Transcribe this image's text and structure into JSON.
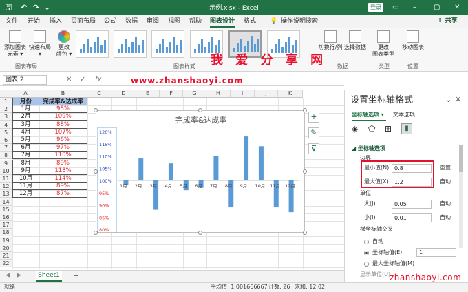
{
  "window": {
    "title": "示例.xlsx  -  Excel",
    "login_label": "登录",
    "minimize": "–",
    "restore": "▢",
    "close": "✕"
  },
  "menu": {
    "items": [
      "文件",
      "开始",
      "插入",
      "页面布局",
      "公式",
      "数据",
      "审阅",
      "视图",
      "帮助",
      "图表设计",
      "格式"
    ],
    "search": "操作说明搜索",
    "share": "共享"
  },
  "ribbon": {
    "add_element": "添加图表\n元素 ▾",
    "quick_layout": "快速布局\n▾",
    "change_color": "更改\n颜色 ▾",
    "switch_rowcol": "切换行/列",
    "select_data": "选择数据",
    "change_type": "更改\n图表类型",
    "move_chart": "移动图表",
    "groups": {
      "layout": "图表布局",
      "styles": "图表样式",
      "data": "数据",
      "type": "类型",
      "location": "位置"
    }
  },
  "watermark": {
    "banner": "我 爱 分 享 网",
    "url": "www.zhanshaoyi.com",
    "corner": "zhanshaoyi.com"
  },
  "formula": {
    "namebox": "图表 2",
    "fx": "fx",
    "cancel": "✕",
    "enter": "✓"
  },
  "columns": [
    "A",
    "B",
    "C",
    "D",
    "E",
    "F",
    "G",
    "H",
    "I",
    "J",
    "K"
  ],
  "rows": [
    "1",
    "2",
    "3",
    "4",
    "5",
    "6",
    "7",
    "8",
    "9",
    "10",
    "11",
    "12",
    "13",
    "14",
    "15",
    "16",
    "17",
    "18",
    "19",
    "20",
    "21",
    "22"
  ],
  "table": {
    "headers": [
      "月份",
      "完成率&达成率"
    ],
    "months": [
      "1月",
      "2月",
      "3月",
      "4月",
      "5月",
      "6月",
      "7月",
      "8月",
      "9月",
      "10月",
      "11月",
      "12月"
    ],
    "values": [
      "98%",
      "109%",
      "88%",
      "107%",
      "96%",
      "97%",
      "110%",
      "89%",
      "118%",
      "114%",
      "89%",
      "87%"
    ]
  },
  "chart_data": {
    "type": "bar",
    "title": "完成率&达成率",
    "categories": [
      "1月",
      "2月",
      "3月",
      "4月",
      "5月",
      "6月",
      "7月",
      "8月",
      "9月",
      "10月",
      "11月",
      "12月"
    ],
    "series": [
      {
        "values": [
          0.98,
          1.09,
          0.88,
          1.07,
          0.96,
          0.97,
          1.1,
          0.89,
          1.18,
          1.14,
          0.89,
          0.87
        ]
      }
    ],
    "ylim": [
      0.8,
      1.2
    ],
    "yticks": [
      "120%",
      "115%",
      "110%",
      "105%",
      "100%",
      "95%",
      "90%",
      "85%",
      "80%"
    ],
    "baseline": 1.0,
    "bar_color": "#5b9bd5",
    "grid": false
  },
  "panel": {
    "title": "设置坐标轴格式",
    "tab1": "坐标轴选项 ▾",
    "tab2": "文本选项",
    "section": "◢ 坐标轴选项",
    "bounds": "边界",
    "min_label": "最小值(N)",
    "min_value": "0.8",
    "reset": "重置",
    "max_label": "最大值(X)",
    "max_value": "1.2",
    "auto1": "自动",
    "units": "单位",
    "major_label": "大(J)",
    "major_value": "0.05",
    "auto2": "自动",
    "minor_label": "小(I)",
    "minor_value": "0.01",
    "auto3": "自动",
    "cross": "横坐标轴交叉",
    "opt_auto": "自动",
    "opt_value": "坐标轴值(E)",
    "opt_value_input": "1",
    "opt_max": "最大坐标轴值(M)",
    "display_units": "显示单位(U)"
  },
  "sheet": {
    "tab": "Sheet1",
    "add": "+"
  },
  "status": {
    "ready": "就绪",
    "average": "平均值: 1.001666667",
    "count": "计数: 26",
    "sum": "求和: 12.02"
  }
}
